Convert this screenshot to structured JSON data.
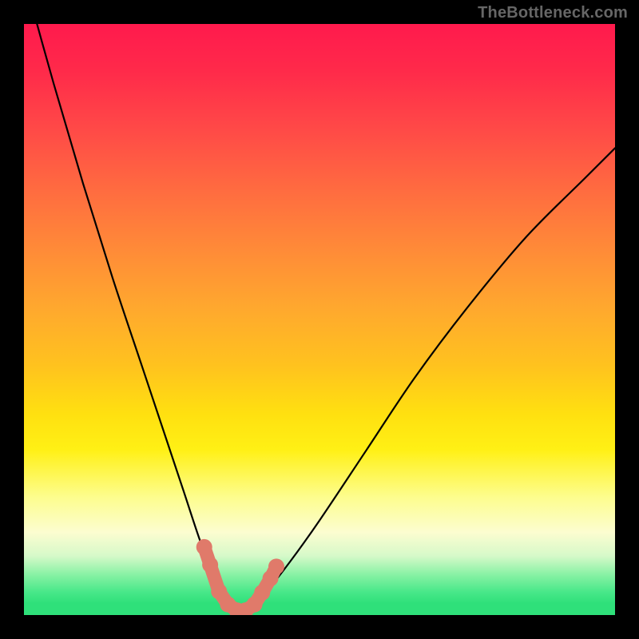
{
  "watermark": "TheBottleneck.com",
  "colors": {
    "frame": "#000000",
    "dot_fill": "#e07a6a",
    "curve_stroke": "#000000",
    "gradient_top": "#ff1a4d",
    "gradient_bottom": "#2fe07a"
  },
  "chart_data": {
    "type": "line",
    "title": "",
    "xlabel": "",
    "ylabel": "",
    "xlim": [
      0,
      100
    ],
    "ylim": [
      0,
      100
    ],
    "note": "V-shaped bottleneck curve over a red→yellow→green vertical gradient; minimum (green zone) around x≈36; coral dots mark data points near the valley, joined by a rounded connector",
    "series": [
      {
        "name": "left_branch",
        "x": [
          0,
          5,
          10,
          15,
          20,
          24,
          27,
          30,
          32.5,
          35,
          36
        ],
        "y": [
          108,
          90,
          73,
          57,
          42,
          30,
          21,
          12,
          6,
          1.5,
          0.5
        ]
      },
      {
        "name": "right_branch",
        "x": [
          36,
          38,
          41,
          45,
          50,
          58,
          66,
          75,
          85,
          95,
          100
        ],
        "y": [
          0.5,
          1.5,
          4,
          9,
          16,
          28,
          40,
          52,
          64,
          74,
          79
        ]
      }
    ],
    "points": [
      {
        "x": 30.5,
        "y": 11.5
      },
      {
        "x": 31.5,
        "y": 8.5
      },
      {
        "x": 33,
        "y": 4
      },
      {
        "x": 34.5,
        "y": 1.8
      },
      {
        "x": 36,
        "y": 0.8
      },
      {
        "x": 37.5,
        "y": 0.8
      },
      {
        "x": 39,
        "y": 1.8
      },
      {
        "x": 40.3,
        "y": 3.8
      },
      {
        "x": 41.7,
        "y": 6.2
      },
      {
        "x": 42.7,
        "y": 8.2
      }
    ],
    "background_gradient": {
      "direction": "vertical",
      "stops": [
        {
          "pos": 0.0,
          "color": "#ff1a4d"
        },
        {
          "pos": 0.3,
          "color": "#ff7a3c"
        },
        {
          "pos": 0.6,
          "color": "#ffd818"
        },
        {
          "pos": 0.8,
          "color": "#fdfd8d"
        },
        {
          "pos": 0.92,
          "color": "#9cf3ae"
        },
        {
          "pos": 1.0,
          "color": "#2fe07a"
        }
      ]
    }
  }
}
